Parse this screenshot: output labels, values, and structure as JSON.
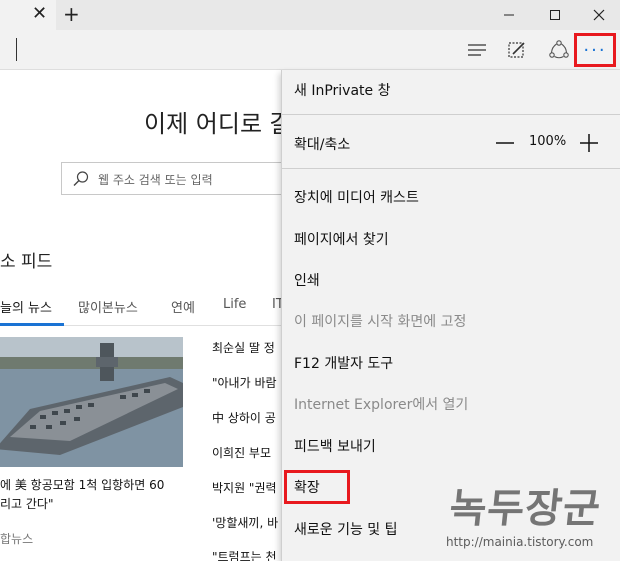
{
  "window": {
    "minimize_glyph": "—",
    "maximize_glyph": "☐",
    "close_glyph": "✕"
  },
  "tab": {
    "close_glyph": "✕",
    "new_tab_glyph": "+"
  },
  "toolbar": {
    "icons": [
      "hub-icon",
      "web-note-icon",
      "share-icon",
      "more-icon"
    ],
    "more_label": "···"
  },
  "page": {
    "heading": "이제 어디로 갈",
    "search_placeholder": "웹 주소 검색 또는 입력",
    "feed_title": "소 피드",
    "tabs": [
      "늘의 뉴스",
      "많이본뉴스",
      "연예",
      "Life",
      "IT"
    ],
    "news_list": [
      "최순실 딸 정",
      "\"아내가 바람",
      "中 상하이 공",
      "이희진 부모",
      "박지원 \"권력",
      "'망할새끼, 바",
      "\"트럼프는 천"
    ],
    "headline_main_1": "에 美 항공모함 1척 입항하면 60",
    "headline_main_2": "리고 간다\"",
    "news_source": "합뉴스"
  },
  "menu": {
    "items": [
      {
        "label": "새 InPrivate 창",
        "disabled": false
      },
      {
        "label": "확대/축소",
        "disabled": false
      },
      {
        "label": "장치에 미디어 캐스트",
        "disabled": false
      },
      {
        "label": "페이지에서 찾기",
        "disabled": false
      },
      {
        "label": "인쇄",
        "disabled": false
      },
      {
        "label": "이 페이지를 시작 화면에 고정",
        "disabled": true
      },
      {
        "label": "F12 개발자 도구",
        "disabled": false
      },
      {
        "label": "Internet Explorer에서 열기",
        "disabled": true
      },
      {
        "label": "피드백 보내기",
        "disabled": false
      },
      {
        "label": "확장",
        "disabled": false
      },
      {
        "label": "새로운 기능 및 팁",
        "disabled": false
      }
    ],
    "zoom_value": "100%"
  },
  "watermark": {
    "logo_text": "녹두장군",
    "url": "http://mainia.tistory.com"
  },
  "colors": {
    "highlight": "#e8191e",
    "accent": "#1a73d4",
    "menu_bg": "#f2f2f2"
  }
}
